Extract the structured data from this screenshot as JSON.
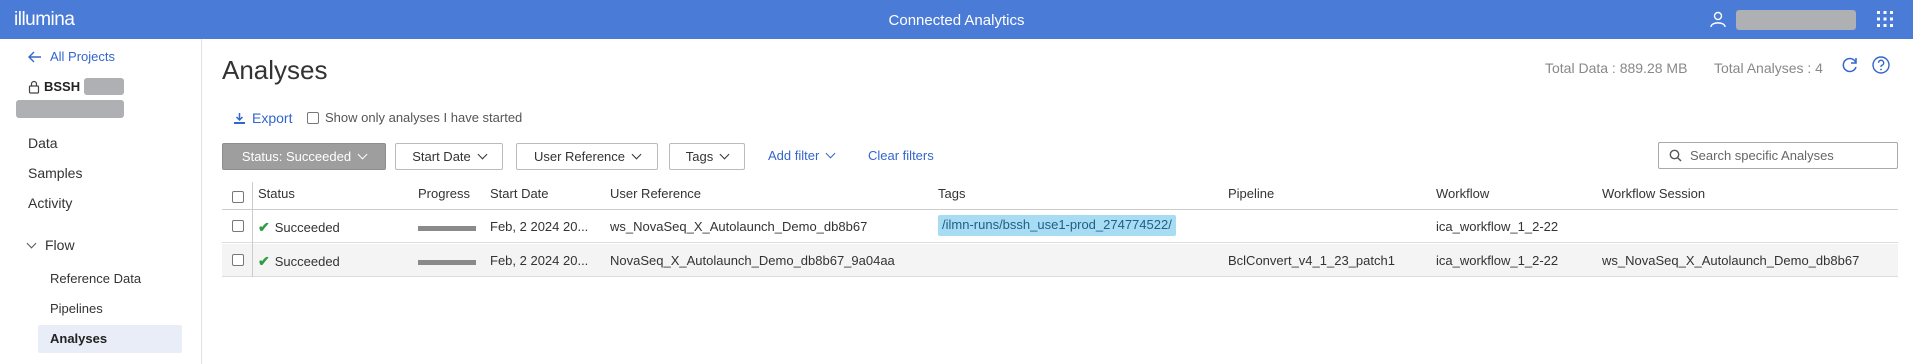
{
  "topbar": {
    "logo": "illumina",
    "app_title": "Connected Analytics",
    "bg_color": "#4a7bd6"
  },
  "sidebar": {
    "back_link": "All Projects",
    "project_prefix": "BSSH",
    "nav": [
      {
        "label": "Data"
      },
      {
        "label": "Samples"
      },
      {
        "label": "Activity"
      }
    ],
    "flow": {
      "label": "Flow",
      "items": [
        {
          "label": "Reference Data"
        },
        {
          "label": "Pipelines"
        },
        {
          "label": "Analyses",
          "active": true
        }
      ]
    }
  },
  "page": {
    "title": "Analyses",
    "total_data": "Total Data : 889.28 MB",
    "total_analyses": "Total Analyses : 4"
  },
  "actions": {
    "export": "Export",
    "show_only": "Show only analyses I have started"
  },
  "filters": {
    "status": "Status: Succeeded",
    "start_date": "Start Date",
    "user_reference": "User Reference",
    "tags": "Tags",
    "add_filter": "Add filter",
    "clear_filters": "Clear filters",
    "search_placeholder": "Search specific Analyses"
  },
  "table": {
    "columns": [
      "Status",
      "Progress",
      "Start Date",
      "User Reference",
      "Tags",
      "Pipeline",
      "Workflow",
      "Workflow Session"
    ],
    "rows": [
      {
        "status": "Succeeded",
        "progress": 1.0,
        "start_date": "Feb, 2 2024 20...",
        "user_reference": "ws_NovaSeq_X_Autolaunch_Demo_db8b67",
        "tags": "/ilmn-runs/bssh_use1-prod_274774522/",
        "pipeline": "",
        "workflow": "ica_workflow_1_2-22",
        "workflow_session": ""
      },
      {
        "status": "Succeeded",
        "progress": 1.0,
        "start_date": "Feb, 2 2024 20...",
        "user_reference": "NovaSeq_X_Autolaunch_Demo_db8b67_9a04aa",
        "tags": "",
        "pipeline": "BclConvert_v4_1_23_patch1",
        "workflow": "ica_workflow_1_2-22",
        "workflow_session": "ws_NovaSeq_X_Autolaunch_Demo_db8b67"
      }
    ]
  },
  "colors": {
    "accent": "#3366cc",
    "success": "#2e9e44",
    "tag_bg": "#a8dcf2",
    "active_filter": "#9e9e9e"
  }
}
